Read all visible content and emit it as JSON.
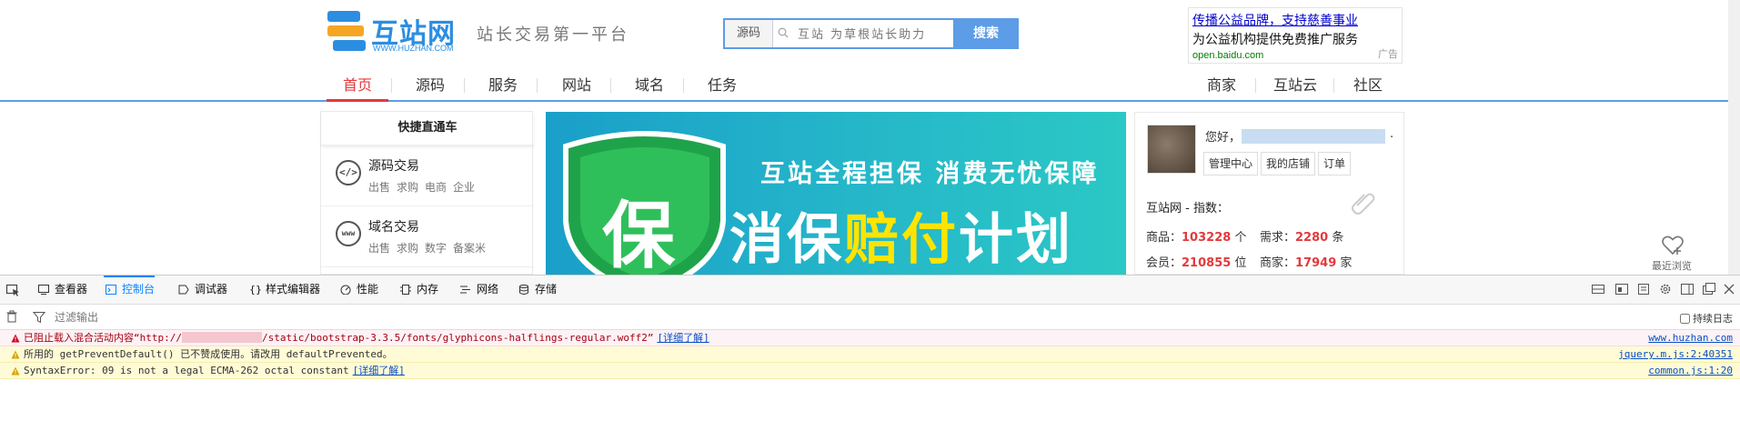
{
  "header": {
    "logo_text": "互站网",
    "logo_url": "WWW.HUZHAN.COM",
    "slogan": "站长交易第一平台",
    "search": {
      "category": "源码",
      "placeholder": "互站 为草根站长助力",
      "button": "搜索"
    },
    "ad": {
      "title": "传播公益品牌，支持慈善事业",
      "desc": "为公益机构提供免费推广服务",
      "url": "open.baidu.com",
      "tag": "广告"
    }
  },
  "nav": {
    "left": [
      "首页",
      "源码",
      "服务",
      "网站",
      "域名",
      "任务"
    ],
    "right": [
      "商家",
      "互站云",
      "社区"
    ],
    "active": "首页"
  },
  "quick": {
    "title": "快捷直通车",
    "items": [
      {
        "icon": "code-icon",
        "glyph": "</>",
        "title": "源码交易",
        "links": [
          "出售",
          "求购",
          "电商",
          "企业"
        ]
      },
      {
        "icon": "www-icon",
        "glyph": "www",
        "title": "域名交易",
        "links": [
          "出售",
          "求购",
          "数字",
          "备案米"
        ]
      }
    ]
  },
  "banner": {
    "line1": "互站全程担保 消费无忧保障",
    "shield_char": "保",
    "line2a": "消保",
    "line2b": "赔付",
    "line2c": "计划"
  },
  "user": {
    "hello": "您好，",
    "suffix": ".",
    "buttons": [
      "管理中心",
      "我的店铺",
      "订单"
    ],
    "index_title": "互站网 - 指数：",
    "stats": [
      {
        "label": "商品：",
        "value": "103228",
        "unit": "个"
      },
      {
        "label": "需求：",
        "value": "2280",
        "unit": "条"
      },
      {
        "label": "会员：",
        "value": "210855",
        "unit": "位"
      },
      {
        "label": "商家：",
        "value": "17949",
        "unit": "家"
      }
    ]
  },
  "recent": {
    "label": "最近浏览"
  },
  "devtools": {
    "tabs": [
      "查看器",
      "控制台",
      "调试器",
      "样式编辑器",
      "性能",
      "内存",
      "网络",
      "存储"
    ],
    "active_tab": "控制台",
    "filter_placeholder": "过滤输出",
    "persist_label": "持续日志",
    "messages": [
      {
        "level": "error",
        "text_before": "已阻止载入混合活动内容“http://",
        "text_after": "/static/bootstrap-3.3.5/fonts/glyphicons-halflings-regular.woff2”",
        "link": "[详细了解]",
        "source": "www.huzhan.com"
      },
      {
        "level": "warning",
        "text_before": "所用的 getPreventDefault() 已不赞成使用。请改用 defaultPrevented。",
        "text_after": "",
        "link": "",
        "source": "jquery.m.js:2:40351"
      },
      {
        "level": "warning",
        "text_before": "SyntaxError: 09 is not a legal ECMA-262 octal constant",
        "text_after": "",
        "link": "[详细了解]",
        "source": "common.js:1:20"
      }
    ]
  },
  "colors": {
    "accent": "#5d9ce6",
    "active_nav": "#e4393c",
    "stat_value": "#e4393c",
    "devtools_active": "#0a84ff"
  }
}
